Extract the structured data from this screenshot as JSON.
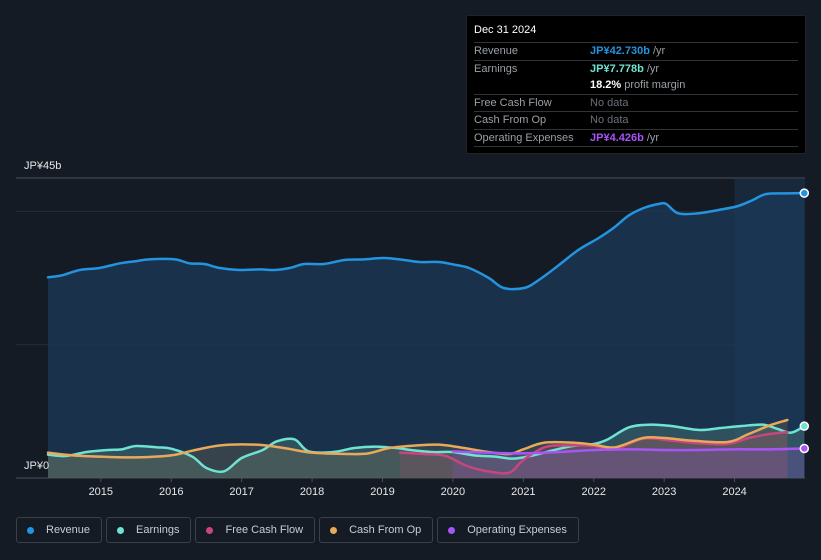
{
  "tooltip": {
    "date": "Dec 31 2024",
    "rows": [
      {
        "label": "Revenue",
        "value": "JP¥42.730b",
        "unit": "/yr",
        "color": "#2394df"
      },
      {
        "label": "Earnings",
        "value": "JP¥7.778b",
        "unit": "/yr",
        "color": "#6fe3d2"
      },
      {
        "label": "",
        "value": "18.2%",
        "unit": "profit margin",
        "color": "#ffffff"
      },
      {
        "label": "Free Cash Flow",
        "value": "No data",
        "unit": "",
        "color": ""
      },
      {
        "label": "Cash From Op",
        "value": "No data",
        "unit": "",
        "color": ""
      },
      {
        "label": "Operating Expenses",
        "value": "JP¥4.426b",
        "unit": "/yr",
        "color": "#a855f7"
      }
    ]
  },
  "legend": [
    {
      "label": "Revenue",
      "color": "#2394df"
    },
    {
      "label": "Earnings",
      "color": "#6fe3d2"
    },
    {
      "label": "Free Cash Flow",
      "color": "#c9457f"
    },
    {
      "label": "Cash From Op",
      "color": "#e8a95a"
    },
    {
      "label": "Operating Expenses",
      "color": "#a855f7"
    }
  ],
  "chart_data": {
    "type": "area",
    "title": "",
    "xlabel": "",
    "ylabel": "",
    "ylim": [
      0,
      45
    ],
    "xlim": [
      2014.25,
      2025.0
    ],
    "y_tick_labels": [
      "JP¥0",
      "JP¥45b"
    ],
    "x_tick_labels": [
      "2015",
      "2016",
      "2017",
      "2018",
      "2019",
      "2020",
      "2021",
      "2022",
      "2023",
      "2024"
    ],
    "x_ticks": [
      2015,
      2016,
      2017,
      2018,
      2019,
      2020,
      2021,
      2022,
      2023,
      2024
    ],
    "highlight_from": 2024.0,
    "grid": true,
    "series": [
      {
        "name": "Revenue",
        "color": "#2394df",
        "points": [
          [
            2014.25,
            30.1
          ],
          [
            2014.45,
            30.4
          ],
          [
            2014.7,
            31.2
          ],
          [
            2014.98,
            31.5
          ],
          [
            2015.27,
            32.2
          ],
          [
            2015.48,
            32.5
          ],
          [
            2015.69,
            32.8
          ],
          [
            2016.05,
            32.8
          ],
          [
            2016.26,
            32.2
          ],
          [
            2016.47,
            32.1
          ],
          [
            2016.69,
            31.5
          ],
          [
            2016.97,
            31.2
          ],
          [
            2017.26,
            31.3
          ],
          [
            2017.47,
            31.2
          ],
          [
            2017.68,
            31.5
          ],
          [
            2017.89,
            32.1
          ],
          [
            2018.17,
            32.1
          ],
          [
            2018.46,
            32.7
          ],
          [
            2018.74,
            32.8
          ],
          [
            2019.03,
            33.0
          ],
          [
            2019.31,
            32.7
          ],
          [
            2019.52,
            32.4
          ],
          [
            2019.8,
            32.4
          ],
          [
            2020.02,
            32.0
          ],
          [
            2020.23,
            31.5
          ],
          [
            2020.51,
            30.0
          ],
          [
            2020.72,
            28.5
          ],
          [
            2021.01,
            28.5
          ],
          [
            2021.22,
            29.7
          ],
          [
            2021.5,
            31.9
          ],
          [
            2021.78,
            34.2
          ],
          [
            2022.07,
            36.0
          ],
          [
            2022.28,
            37.5
          ],
          [
            2022.5,
            39.4
          ],
          [
            2022.71,
            40.5
          ],
          [
            2022.92,
            41.1
          ],
          [
            2023.03,
            41.1
          ],
          [
            2023.2,
            39.7
          ],
          [
            2023.48,
            39.7
          ],
          [
            2023.77,
            40.2
          ],
          [
            2024.05,
            40.8
          ],
          [
            2024.26,
            41.7
          ],
          [
            2024.45,
            42.6
          ],
          [
            2024.76,
            42.7
          ],
          [
            2024.99,
            42.73
          ]
        ]
      },
      {
        "name": "Earnings",
        "color": "#6fe3d2",
        "points": [
          [
            2014.25,
            3.5
          ],
          [
            2014.5,
            3.3
          ],
          [
            2014.8,
            3.9
          ],
          [
            2015.1,
            4.2
          ],
          [
            2015.3,
            4.3
          ],
          [
            2015.5,
            4.8
          ],
          [
            2015.8,
            4.6
          ],
          [
            2016.0,
            4.4
          ],
          [
            2016.3,
            3.2
          ],
          [
            2016.5,
            1.5
          ],
          [
            2016.75,
            1.0
          ],
          [
            2017.0,
            3.0
          ],
          [
            2017.3,
            4.2
          ],
          [
            2017.5,
            5.5
          ],
          [
            2017.75,
            5.8
          ],
          [
            2017.95,
            4.0
          ],
          [
            2018.3,
            3.9
          ],
          [
            2018.6,
            4.5
          ],
          [
            2018.9,
            4.7
          ],
          [
            2019.2,
            4.5
          ],
          [
            2019.4,
            4.2
          ],
          [
            2019.7,
            3.9
          ],
          [
            2020.0,
            3.9
          ],
          [
            2020.3,
            3.4
          ],
          [
            2020.6,
            3.2
          ],
          [
            2020.85,
            2.9
          ],
          [
            2021.1,
            3.3
          ],
          [
            2021.4,
            4.1
          ],
          [
            2021.7,
            4.8
          ],
          [
            2022.0,
            5.1
          ],
          [
            2022.2,
            5.8
          ],
          [
            2022.5,
            7.6
          ],
          [
            2022.8,
            8.0
          ],
          [
            2023.1,
            7.8
          ],
          [
            2023.5,
            7.2
          ],
          [
            2023.8,
            7.5
          ],
          [
            2024.1,
            7.8
          ],
          [
            2024.4,
            8.0
          ],
          [
            2024.6,
            7.4
          ],
          [
            2024.8,
            6.8
          ],
          [
            2024.99,
            7.78
          ]
        ]
      },
      {
        "name": "Free Cash Flow",
        "color": "#c9457f",
        "points": [
          [
            2019.25,
            3.8
          ],
          [
            2019.6,
            3.6
          ],
          [
            2019.9,
            3.3
          ],
          [
            2020.2,
            1.8
          ],
          [
            2020.5,
            1.0
          ],
          [
            2020.8,
            0.8
          ],
          [
            2021.0,
            2.7
          ],
          [
            2021.3,
            4.6
          ],
          [
            2021.6,
            4.9
          ],
          [
            2022.0,
            4.8
          ],
          [
            2022.3,
            4.3
          ],
          [
            2022.7,
            5.9
          ],
          [
            2023.1,
            5.6
          ],
          [
            2023.5,
            5.2
          ],
          [
            2023.9,
            5.1
          ],
          [
            2024.2,
            6.0
          ],
          [
            2024.5,
            6.6
          ],
          [
            2024.75,
            6.9
          ]
        ]
      },
      {
        "name": "Cash From Op",
        "color": "#e8a95a",
        "points": [
          [
            2014.25,
            3.8
          ],
          [
            2014.6,
            3.4
          ],
          [
            2015.0,
            3.2
          ],
          [
            2015.5,
            3.1
          ],
          [
            2016.0,
            3.4
          ],
          [
            2016.3,
            4.1
          ],
          [
            2016.7,
            4.9
          ],
          [
            2017.2,
            5.0
          ],
          [
            2017.6,
            4.5
          ],
          [
            2018.0,
            3.8
          ],
          [
            2018.5,
            3.6
          ],
          [
            2018.8,
            3.7
          ],
          [
            2019.1,
            4.5
          ],
          [
            2019.5,
            4.9
          ],
          [
            2019.8,
            5.0
          ],
          [
            2020.1,
            4.6
          ],
          [
            2020.5,
            3.9
          ],
          [
            2020.8,
            3.6
          ],
          [
            2021.0,
            4.3
          ],
          [
            2021.3,
            5.3
          ],
          [
            2021.7,
            5.3
          ],
          [
            2022.0,
            5.0
          ],
          [
            2022.3,
            4.6
          ],
          [
            2022.7,
            6.0
          ],
          [
            2023.0,
            6.0
          ],
          [
            2023.4,
            5.6
          ],
          [
            2023.9,
            5.4
          ],
          [
            2024.2,
            6.6
          ],
          [
            2024.5,
            7.9
          ],
          [
            2024.75,
            8.7
          ]
        ]
      },
      {
        "name": "Operating Expenses",
        "color": "#a855f7",
        "points": [
          [
            2020.0,
            4.0
          ],
          [
            2020.5,
            3.8
          ],
          [
            2021.0,
            3.7
          ],
          [
            2021.5,
            3.9
          ],
          [
            2022.0,
            4.2
          ],
          [
            2022.5,
            4.3
          ],
          [
            2023.0,
            4.2
          ],
          [
            2023.5,
            4.2
          ],
          [
            2024.0,
            4.3
          ],
          [
            2024.5,
            4.3
          ],
          [
            2024.99,
            4.43
          ]
        ]
      }
    ]
  }
}
